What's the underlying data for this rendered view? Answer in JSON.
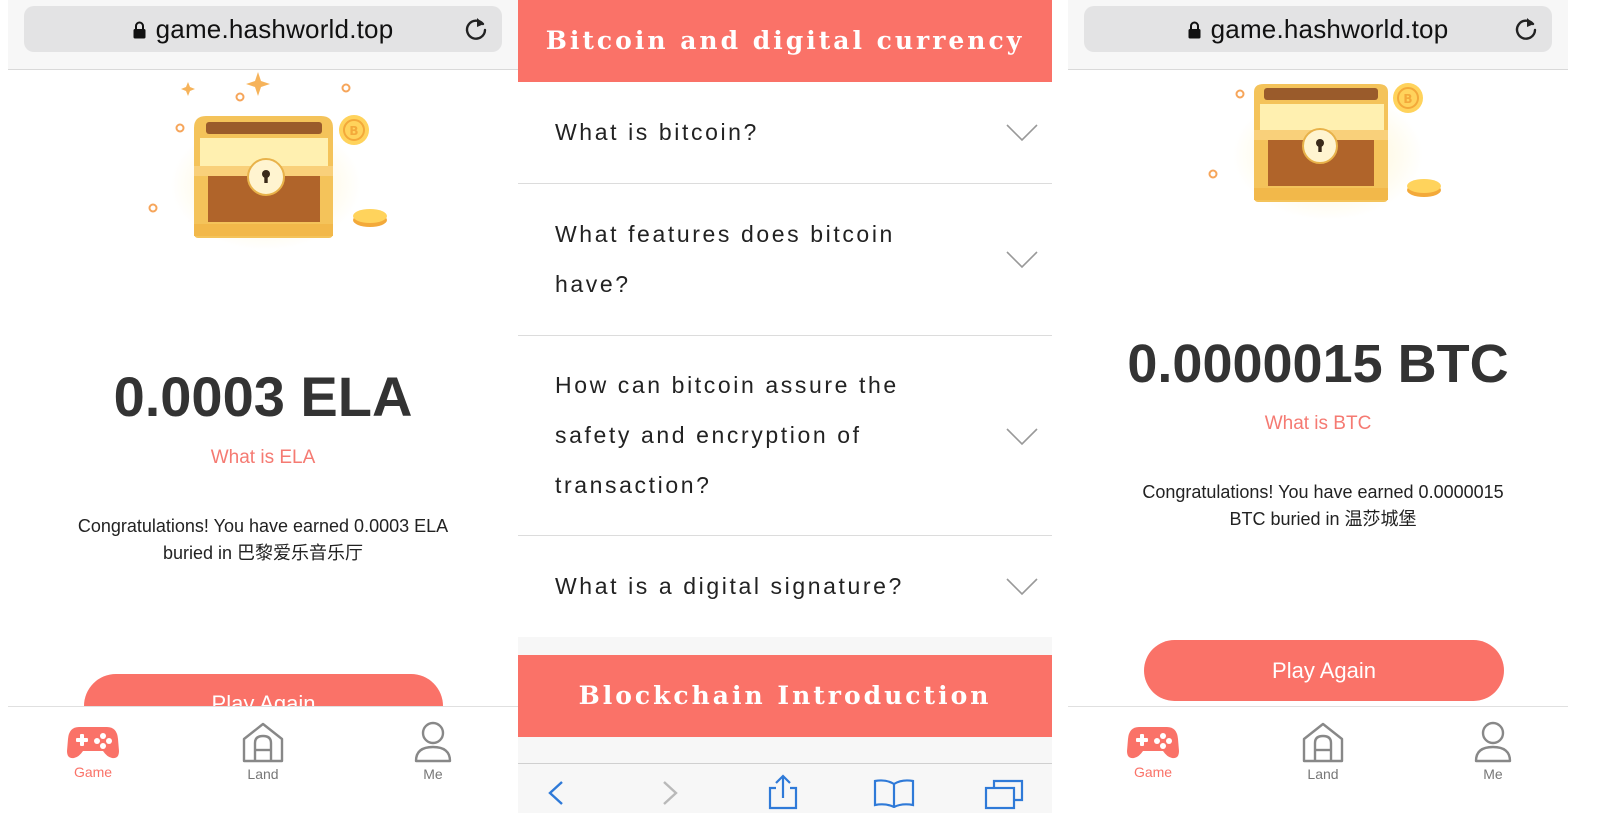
{
  "left": {
    "browser": {
      "url": "game.hashworld.top"
    },
    "reward": {
      "amount": "0.0003 ELA",
      "what_link": "What is ELA",
      "congrats_line1": "Congratulations! You have earned 0.0003 ELA",
      "congrats_line2": "buried in 巴黎爱乐音乐厅"
    },
    "play_again": "Play Again",
    "tabs": [
      {
        "label": "Game",
        "icon": "gamepad-icon",
        "active": true
      },
      {
        "label": "Land",
        "icon": "house-icon",
        "active": false
      },
      {
        "label": "Me",
        "icon": "user-icon",
        "active": false
      }
    ]
  },
  "middle": {
    "section1_title": "Bitcoin and digital currency",
    "faq": [
      {
        "q_lines": [
          "What is bitcoin?"
        ]
      },
      {
        "q_lines": [
          "What features does bitcoin",
          "have?"
        ]
      },
      {
        "q_lines": [
          "How can bitcoin assure the",
          "safety and encryption of",
          "transaction?"
        ]
      },
      {
        "q_lines": [
          "What is a digital signature?"
        ]
      }
    ],
    "section2_title": "Blockchain Introduction",
    "toolbar_icons": [
      "back-icon",
      "forward-icon",
      "share-icon",
      "bookmarks-icon",
      "tabs-icon"
    ]
  },
  "right": {
    "browser": {
      "url": "game.hashworld.top"
    },
    "reward": {
      "amount": "0.0000015 BTC",
      "what_link": "What is BTC",
      "congrats_line1": "Congratulations! You have earned 0.0000015",
      "congrats_line2": "BTC buried in 温莎城堡"
    },
    "play_again": "Play Again",
    "tabs": [
      {
        "label": "Game",
        "icon": "gamepad-icon",
        "active": true
      },
      {
        "label": "Land",
        "icon": "house-icon",
        "active": false
      },
      {
        "label": "Me",
        "icon": "user-icon",
        "active": false
      }
    ]
  },
  "colors": {
    "accent": "#fa7268",
    "link": "#f57a72",
    "url_bar": "#e3e3e4",
    "text_dark": "#333333"
  }
}
